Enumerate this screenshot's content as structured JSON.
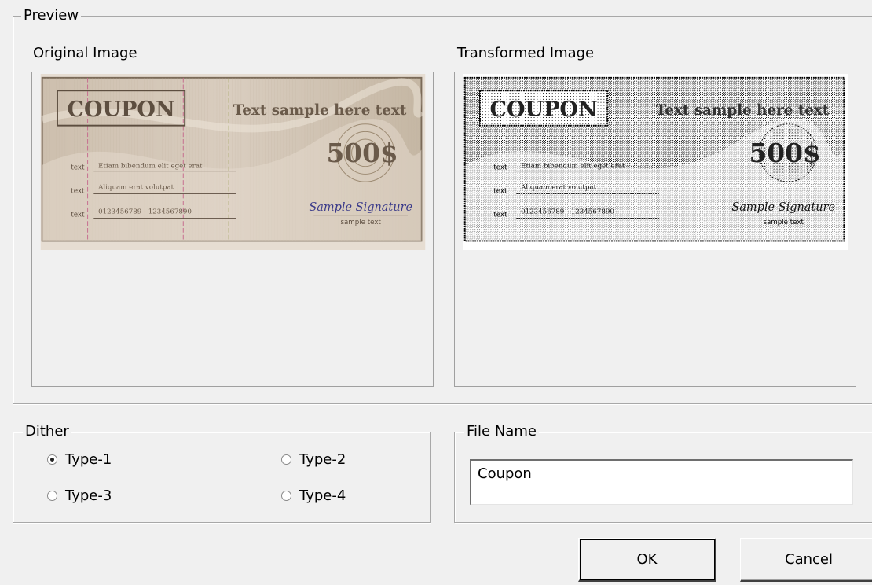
{
  "preview": {
    "legend": "Preview",
    "original_label": "Original Image",
    "transformed_label": "Transformed Image"
  },
  "coupon": {
    "heading": "COUPON",
    "tagline": "Text sample here text",
    "amount": "500$",
    "field_label": "text",
    "lines": [
      "Etiam bibendum elit eget erat",
      "Aliquam erat volutpat",
      "0123456789 - 1234567890"
    ],
    "signature": "Sample Signature",
    "signature_caption": "sample text"
  },
  "dither": {
    "legend": "Dither",
    "options": [
      "Type-1",
      "Type-2",
      "Type-3",
      "Type-4"
    ],
    "selected": "Type-1"
  },
  "file_name": {
    "legend": "File Name",
    "value": "Coupon"
  },
  "buttons": {
    "ok": "OK",
    "cancel": "Cancel"
  },
  "colors": {
    "coupon_bg": "#c8bba9",
    "coupon_border": "#7a6a58",
    "coupon_text": "#5d4e40",
    "signature": "#3a3a8a"
  }
}
